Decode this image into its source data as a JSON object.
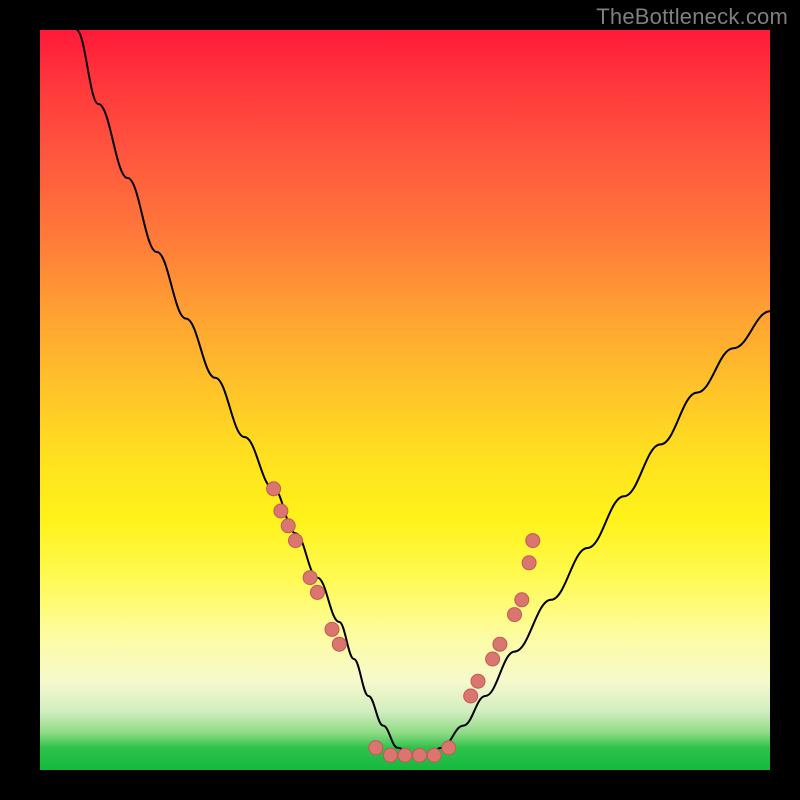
{
  "watermark": "TheBottleneck.com",
  "chart_data": {
    "type": "line",
    "title": "",
    "xlabel": "",
    "ylabel": "",
    "xlim": [
      0,
      100
    ],
    "ylim": [
      0,
      100
    ],
    "grid": false,
    "series": [
      {
        "name": "bottleneck-curve",
        "x": [
          5,
          8,
          12,
          16,
          20,
          24,
          28,
          32,
          35,
          38,
          41,
          43,
          45,
          47,
          49,
          51,
          53,
          55,
          58,
          61,
          65,
          70,
          75,
          80,
          85,
          90,
          95,
          100
        ],
        "y": [
          100,
          90,
          80,
          70,
          61,
          53,
          45,
          38,
          32,
          26,
          20,
          15,
          10,
          6,
          3,
          2,
          2,
          3,
          6,
          10,
          16,
          23,
          30,
          37,
          44,
          51,
          57,
          62
        ]
      }
    ],
    "markers": {
      "name": "highlight-points",
      "left_cluster": {
        "x": [
          32,
          33,
          34,
          35,
          37,
          38,
          40,
          41
        ],
        "y": [
          38,
          35,
          33,
          31,
          26,
          24,
          19,
          17
        ]
      },
      "bottom_cluster": {
        "x": [
          46,
          48,
          50,
          52,
          54,
          56
        ],
        "y": [
          3,
          2,
          2,
          2,
          2,
          3
        ]
      },
      "right_cluster": {
        "x": [
          59,
          60,
          62,
          63,
          65,
          66,
          67,
          67.5
        ],
        "y": [
          10,
          12,
          15,
          17,
          21,
          23,
          28,
          31
        ]
      }
    },
    "background_gradient": {
      "top": "#ff1a3a",
      "mid_upper": "#ffa033",
      "mid": "#fff21a",
      "mid_lower": "#f6f9cc",
      "bottom": "#14b93e"
    }
  }
}
